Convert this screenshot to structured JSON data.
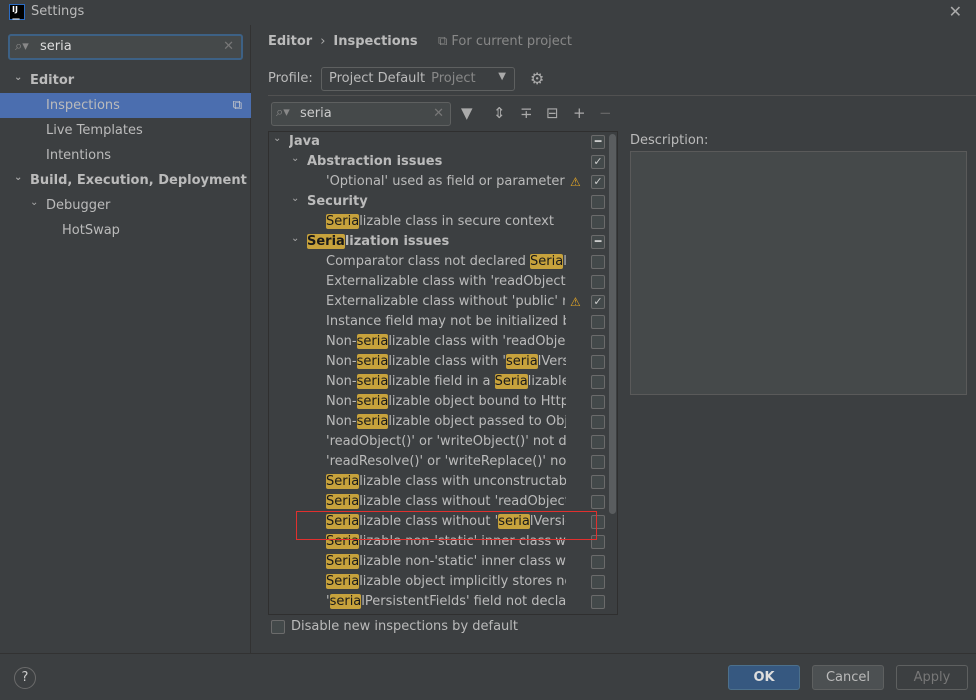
{
  "window": {
    "title": "Settings"
  },
  "sidebar": {
    "search": {
      "value": "seria"
    },
    "items": [
      {
        "label": "Editor",
        "level": 0,
        "expanded": true,
        "bold": true
      },
      {
        "label": "Inspections",
        "level": 1,
        "selected": true
      },
      {
        "label": "Live Templates",
        "level": 1
      },
      {
        "label": "Intentions",
        "level": 1
      },
      {
        "label": "Build, Execution, Deployment",
        "level": 0,
        "expanded": true,
        "bold": true
      },
      {
        "label": "Debugger",
        "level": 1,
        "expanded": true
      },
      {
        "label": "HotSwap",
        "level": 2
      }
    ]
  },
  "header": {
    "crumb_parent": "Editor",
    "crumb_current": "Inspections",
    "scope": "For current project"
  },
  "profile": {
    "label": "Profile:",
    "value": "Project Default",
    "scope": "Project"
  },
  "filter": {
    "value": "seria"
  },
  "tree": [
    {
      "level": 0,
      "bold": true,
      "arrow": true,
      "check": "mixed",
      "segs": [
        {
          "t": "Java"
        }
      ]
    },
    {
      "level": 1,
      "bold": true,
      "arrow": true,
      "check": "checked",
      "segs": [
        {
          "t": "Abstraction issues"
        }
      ]
    },
    {
      "level": 2,
      "check": "checked",
      "warn": true,
      "segs": [
        {
          "t": "'Optional' used as field or parameter type"
        }
      ]
    },
    {
      "level": 1,
      "bold": true,
      "arrow": true,
      "check": "none",
      "segs": [
        {
          "t": "Security"
        }
      ]
    },
    {
      "level": 2,
      "check": "none",
      "segs": [
        {
          "t": "Seria",
          "h": true
        },
        {
          "t": "lizable class in secure context"
        }
      ]
    },
    {
      "level": 1,
      "bold": true,
      "arrow": true,
      "check": "mixed",
      "segs": [
        {
          "t": "Seria",
          "h": true
        },
        {
          "t": "lization issues"
        }
      ]
    },
    {
      "level": 2,
      "check": "none",
      "segs": [
        {
          "t": "Comparator class not declared "
        },
        {
          "t": "Seria",
          "h": true
        },
        {
          "t": "lizable"
        }
      ]
    },
    {
      "level": 2,
      "check": "none",
      "segs": [
        {
          "t": "Externalizable class with 'readObject()' or"
        }
      ]
    },
    {
      "level": 2,
      "check": "checked",
      "warn": true,
      "segs": [
        {
          "t": "Externalizable class without 'public' no-arg"
        }
      ]
    },
    {
      "level": 2,
      "check": "none",
      "segs": [
        {
          "t": "Instance field may not be initialized by 're"
        }
      ]
    },
    {
      "level": 2,
      "check": "none",
      "segs": [
        {
          "t": "Non-"
        },
        {
          "t": "seria",
          "h": true
        },
        {
          "t": "lizable class with 'readObject()'"
        }
      ]
    },
    {
      "level": 2,
      "check": "none",
      "segs": [
        {
          "t": "Non-"
        },
        {
          "t": "seria",
          "h": true
        },
        {
          "t": "lizable class with '"
        },
        {
          "t": "seria",
          "h": true
        },
        {
          "t": "lVersionU"
        }
      ]
    },
    {
      "level": 2,
      "check": "none",
      "segs": [
        {
          "t": "Non-"
        },
        {
          "t": "seria",
          "h": true
        },
        {
          "t": "lizable field in a "
        },
        {
          "t": "Seria",
          "h": true
        },
        {
          "t": "lizable cla"
        }
      ]
    },
    {
      "level": 2,
      "check": "none",
      "segs": [
        {
          "t": "Non-"
        },
        {
          "t": "seria",
          "h": true
        },
        {
          "t": "lizable object bound to HttpSes"
        }
      ]
    },
    {
      "level": 2,
      "check": "none",
      "segs": [
        {
          "t": "Non-"
        },
        {
          "t": "seria",
          "h": true
        },
        {
          "t": "lizable object passed to Object"
        }
      ]
    },
    {
      "level": 2,
      "check": "none",
      "segs": [
        {
          "t": "'readObject()' or 'writeObject()' not decla"
        }
      ]
    },
    {
      "level": 2,
      "check": "none",
      "segs": [
        {
          "t": "'readResolve()' or 'writeReplace()' not dec"
        }
      ]
    },
    {
      "level": 2,
      "check": "none",
      "segs": [
        {
          "t": "Seria",
          "h": true
        },
        {
          "t": "lizable class with unconstructable an"
        }
      ]
    },
    {
      "level": 2,
      "check": "none",
      "segs": [
        {
          "t": "Seria",
          "h": true
        },
        {
          "t": "lizable class without 'readObject()' a"
        }
      ]
    },
    {
      "level": 2,
      "check": "none",
      "segs": [
        {
          "t": "Seria",
          "h": true
        },
        {
          "t": "lizable class without '"
        },
        {
          "t": "seria",
          "h": true
        },
        {
          "t": "lVersionUI"
        }
      ]
    },
    {
      "level": 2,
      "check": "none",
      "segs": [
        {
          "t": "Seria",
          "h": true
        },
        {
          "t": "lizable non-'static' inner class with no"
        }
      ]
    },
    {
      "level": 2,
      "check": "none",
      "segs": [
        {
          "t": "Seria",
          "h": true
        },
        {
          "t": "lizable non-'static' inner class withou"
        }
      ]
    },
    {
      "level": 2,
      "check": "none",
      "segs": [
        {
          "t": "Seria",
          "h": true
        },
        {
          "t": "lizable object implicitly stores non-"
        },
        {
          "t": "S",
          "h": true
        }
      ]
    },
    {
      "level": 2,
      "check": "none",
      "segs": [
        {
          "t": "'"
        },
        {
          "t": "seria",
          "h": true
        },
        {
          "t": "lPersistentFields' field not declared '"
        }
      ]
    }
  ],
  "description": {
    "label": "Description:"
  },
  "options": {
    "disable_new": "Disable new inspections by default"
  },
  "footer": {
    "help": "?",
    "ok": "OK",
    "cancel": "Cancel",
    "apply": "Apply"
  },
  "colors": {
    "accent": "#4b6eaf",
    "highlight": "#c7a23c",
    "ok_button": "#365880",
    "annotation_box": "#e0302e"
  }
}
